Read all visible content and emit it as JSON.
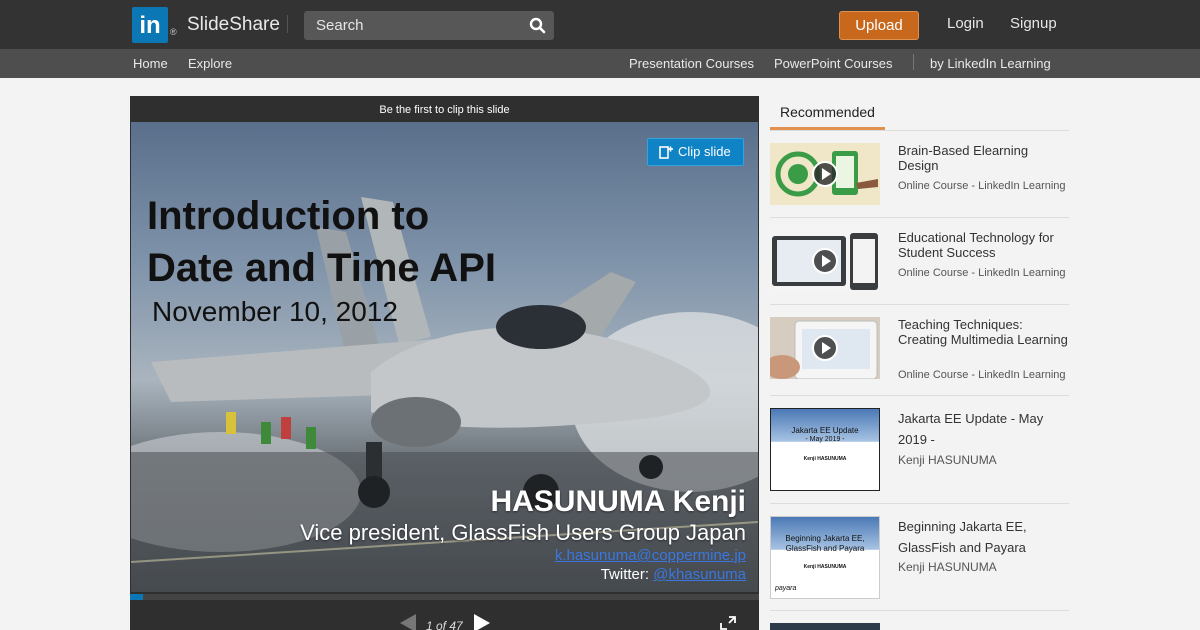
{
  "header": {
    "logo_text": "in",
    "logo_reg": "®",
    "brand": "SlideShare",
    "search_placeholder": "Search",
    "upload_label": "Upload",
    "login_label": "Login",
    "signup_label": "Signup"
  },
  "subnav": {
    "home": "Home",
    "explore": "Explore",
    "presentation_courses": "Presentation Courses",
    "powerpoint_courses": "PowerPoint Courses",
    "linkedin_learning": "by LinkedIn Learning"
  },
  "player": {
    "clip_hint": "Be the first to clip this slide",
    "clip_button": "Clip slide",
    "slide": {
      "title_line1": "Introduction to",
      "title_line2": "Date and Time API",
      "date": "November 10, 2012",
      "author": "HASUNUMA Kenji",
      "role": "Vice president, GlassFish Users Group Japan",
      "email": "k.hasunuma@coppermine.jp",
      "twitter_label": "Twitter: ",
      "twitter_handle": "@khasunuma"
    },
    "page_indicator": "1 of 47",
    "progress": 0.021
  },
  "recommended": {
    "tab_label": "Recommended",
    "items": [
      {
        "title": "Brain-Based Elearning Design",
        "meta": "Online Course - LinkedIn Learning"
      },
      {
        "title": "Educational Technology for Student Success",
        "meta": "Online Course - LinkedIn Learning"
      },
      {
        "title": "Teaching Techniques: Creating Multimedia Learning",
        "meta": "Online Course - LinkedIn Learning"
      },
      {
        "title": "Jakarta EE Update - May 2019 -",
        "meta": "Kenji HASUNUMA",
        "thumb_title": "Jakarta EE Update",
        "thumb_subtitle": "- May 2019 -",
        "thumb_author": "Kenji HASUNUMA"
      },
      {
        "title": "Beginning Jakarta EE, GlassFish and Payara",
        "meta": "Kenji HASUNUMA",
        "thumb_title_line1": "Beginning Jakarta EE,",
        "thumb_title_line2": "GlassFish and Payara",
        "thumb_author": "Kenji HASUNUMA",
        "thumb_logo": "payara"
      }
    ]
  },
  "colors": {
    "topbar": "#333333",
    "subnav": "#4e4e4e",
    "upload": "#c8681d",
    "accent": "#0b77b5",
    "tab_underline": "#e0914f"
  }
}
